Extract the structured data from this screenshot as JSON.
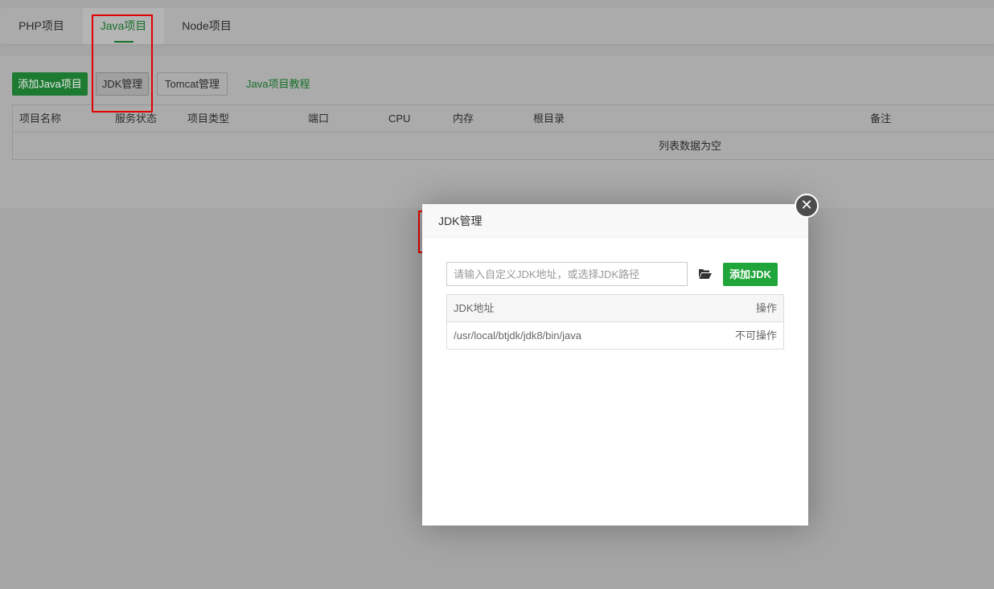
{
  "tabs": [
    {
      "label": "PHP项目"
    },
    {
      "label": "Java项目"
    },
    {
      "label": "Node项目"
    }
  ],
  "toolbar": {
    "add_java_label": "添加Java项目",
    "jdk_manage_label": "JDK管理",
    "tomcat_manage_label": "Tomcat管理",
    "tutorial_label": "Java项目教程"
  },
  "project_table": {
    "columns": [
      "项目名称",
      "服务状态",
      "项目类型",
      "端口",
      "CPU",
      "内存",
      "根目录",
      "备注"
    ],
    "empty_text": "列表数据为空"
  },
  "dialog": {
    "title": "JDK管理",
    "input_placeholder": "请输入自定义JDK地址，或选择JDK路径",
    "add_button": "添加JDK",
    "close_symbol": "✕",
    "table": {
      "columns": [
        "JDK地址",
        "操作"
      ],
      "rows": [
        {
          "path": "/usr/local/btjdk/jdk8/bin/java",
          "action": "不可操作"
        }
      ]
    }
  },
  "colors": {
    "accent": "#20a53a",
    "highlight": "#e20000"
  }
}
